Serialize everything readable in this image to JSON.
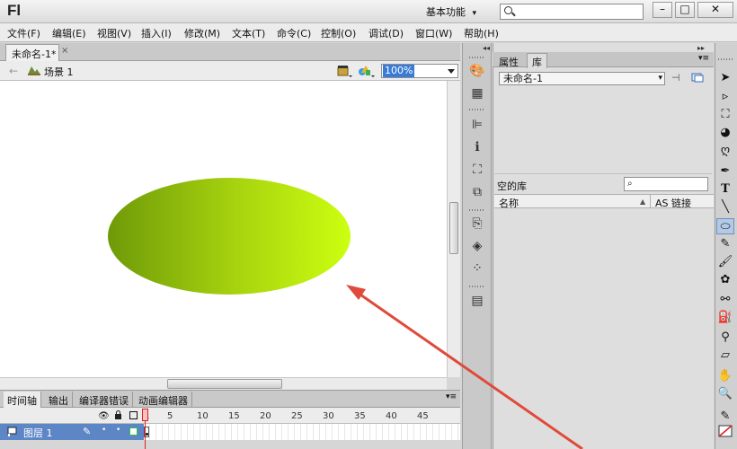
{
  "app": {
    "logo": "Fl"
  },
  "titlebar": {
    "workspace_label": "基本功能",
    "workspace_dropdown_icon": "chevron-down-icon",
    "search_placeholder": "",
    "minimize": "–",
    "maximize": "□",
    "close": "✕"
  },
  "menu": [
    "文件(F)",
    "编辑(E)",
    "视图(V)",
    "插入(I)",
    "修改(M)",
    "文本(T)",
    "命令(C)",
    "控制(O)",
    "调试(D)",
    "窗口(W)",
    "帮助(H)"
  ],
  "document": {
    "tab_label": "未命名-1*",
    "tab_close": "×",
    "scene_label": "场景 1",
    "zoom": "100%"
  },
  "stage": {
    "ellipse_gradient": [
      "#6f9a08",
      "#a9d50f",
      "#ccff10"
    ],
    "annotation_arrow_color": "#e04a3a"
  },
  "timeline": {
    "tabs": [
      "时间轴",
      "输出",
      "编译器错误",
      "动画编辑器"
    ],
    "frame_numbers": [
      "1",
      "5",
      "10",
      "15",
      "20",
      "25",
      "30",
      "35",
      "40",
      "45"
    ],
    "layer_name": "图层 1",
    "header_icons": [
      "eye-icon",
      "lock-icon",
      "outline-icon"
    ]
  },
  "panel": {
    "tabs": [
      "属性",
      "库"
    ],
    "library_doc": "未命名-1",
    "empty_label": "空的库",
    "columns": [
      "名称",
      "AS 链接"
    ]
  },
  "colors": {
    "selection_blue": "#5d86c6",
    "playhead_red": "#e02020",
    "keyframe_green": "#2fbf44"
  }
}
